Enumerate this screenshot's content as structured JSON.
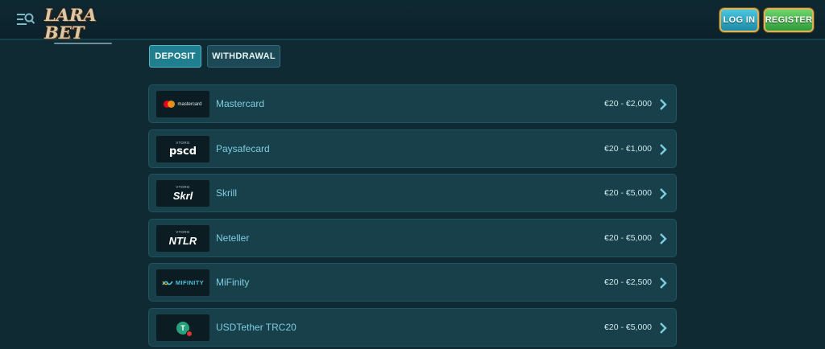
{
  "header": {
    "logo_text": "LARA BET",
    "login_label": "LOG IN",
    "register_label": "REGISTER",
    "menu_icon": "menu-search-icon"
  },
  "tabs": [
    {
      "label": "DEPOSIT",
      "active": true
    },
    {
      "label": "WITHDRAWAL",
      "active": false
    }
  ],
  "methods": [
    {
      "name": "Mastercard",
      "range": "€20 - €2,000",
      "logo": "mastercard",
      "logo_text": "mastercard"
    },
    {
      "name": "Paysafecard",
      "range": "€20 - €1,000",
      "logo": "paysafecard",
      "logo_small": "VTORG",
      "logo_text": "pscd"
    },
    {
      "name": "Skrill",
      "range": "€20 - €5,000",
      "logo": "skrill",
      "logo_small": "VTORG",
      "logo_text": "Skrl"
    },
    {
      "name": "Neteller",
      "range": "€20 - €5,000",
      "logo": "neteller",
      "logo_small": "VTORG",
      "logo_text": "NTLR"
    },
    {
      "name": "MiFinity",
      "range": "€20 - €2,500",
      "logo": "mifinity",
      "logo_text": "MIFINITY"
    },
    {
      "name": "USDTether TRC20",
      "range": "€20 - €5,000",
      "logo": "tether",
      "logo_text": "T"
    }
  ],
  "colors": {
    "background": "#0f2a33",
    "row": "#17404b",
    "accent": "#1f7f8f",
    "method_name": "#7fcde0",
    "login": "#1c8aa7",
    "register": "#2f9c3a"
  }
}
